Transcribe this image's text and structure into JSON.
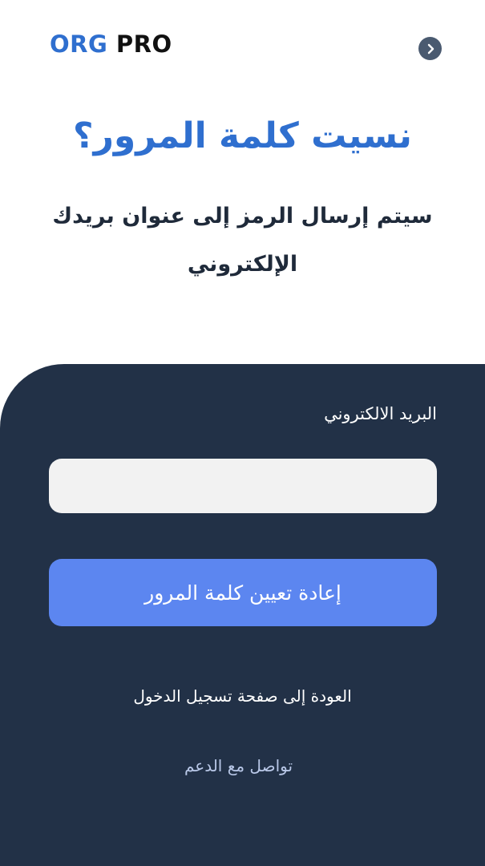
{
  "header": {
    "logo_part1": "ORG",
    "logo_part2": "PRO",
    "back_icon": "chevron-right-icon"
  },
  "main": {
    "title": "نسيت كلمة المرور؟",
    "subtitle": "سيتم إرسال الرمز إلى عنوان بريدك الإلكتروني"
  },
  "form": {
    "email_label": "البريد الالكتروني",
    "email_value": "",
    "reset_button_label": "إعادة تعيين كلمة المرور",
    "back_to_login_label": "العودة إلى صفحة تسجيل الدخول",
    "contact_support_label": "تواصل مع الدعم"
  },
  "colors": {
    "brand_blue": "#2f6fcf",
    "panel_bg": "#223147",
    "button_bg": "#5c86f0"
  }
}
